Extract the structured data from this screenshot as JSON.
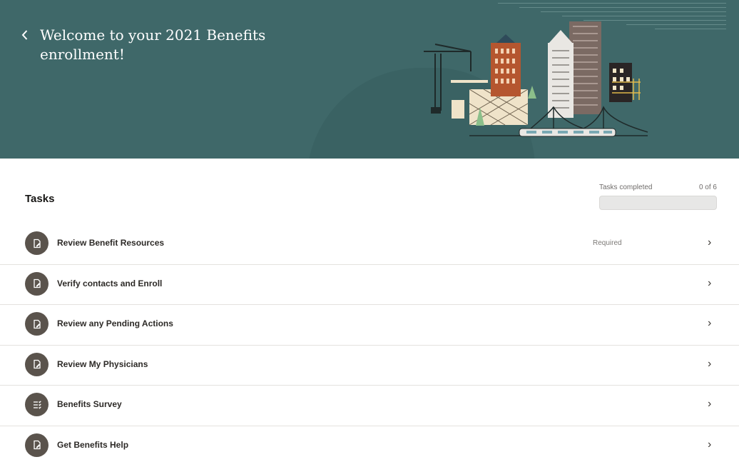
{
  "header": {
    "title": "Welcome to your 2021 Benefits enrollment!",
    "back_icon": "chevron-left-icon",
    "background_color": "#3f6869"
  },
  "tasks_section": {
    "title": "Tasks",
    "progress": {
      "label": "Tasks completed",
      "count_text": "0 of 6",
      "completed_fraction": 0
    }
  },
  "tasks": [
    {
      "label": "Review Benefit Resources",
      "badge": "Required",
      "icon": "document-edit-icon",
      "chevron": "›"
    },
    {
      "label": "Verify contacts and Enroll",
      "badge": "",
      "icon": "document-edit-icon",
      "chevron": "›"
    },
    {
      "label": "Review any Pending Actions",
      "badge": "",
      "icon": "document-edit-icon",
      "chevron": "›"
    },
    {
      "label": "Review My Physicians",
      "badge": "",
      "icon": "document-edit-icon",
      "chevron": "›"
    },
    {
      "label": "Benefits Survey",
      "badge": "",
      "icon": "checklist-icon",
      "chevron": "›"
    },
    {
      "label": "Get Benefits Help",
      "badge": "",
      "icon": "document-edit-icon",
      "chevron": "›"
    }
  ],
  "colors": {
    "accent": "#3f6869",
    "task_icon_bg": "#5a534c",
    "divider": "#e4e2df"
  }
}
